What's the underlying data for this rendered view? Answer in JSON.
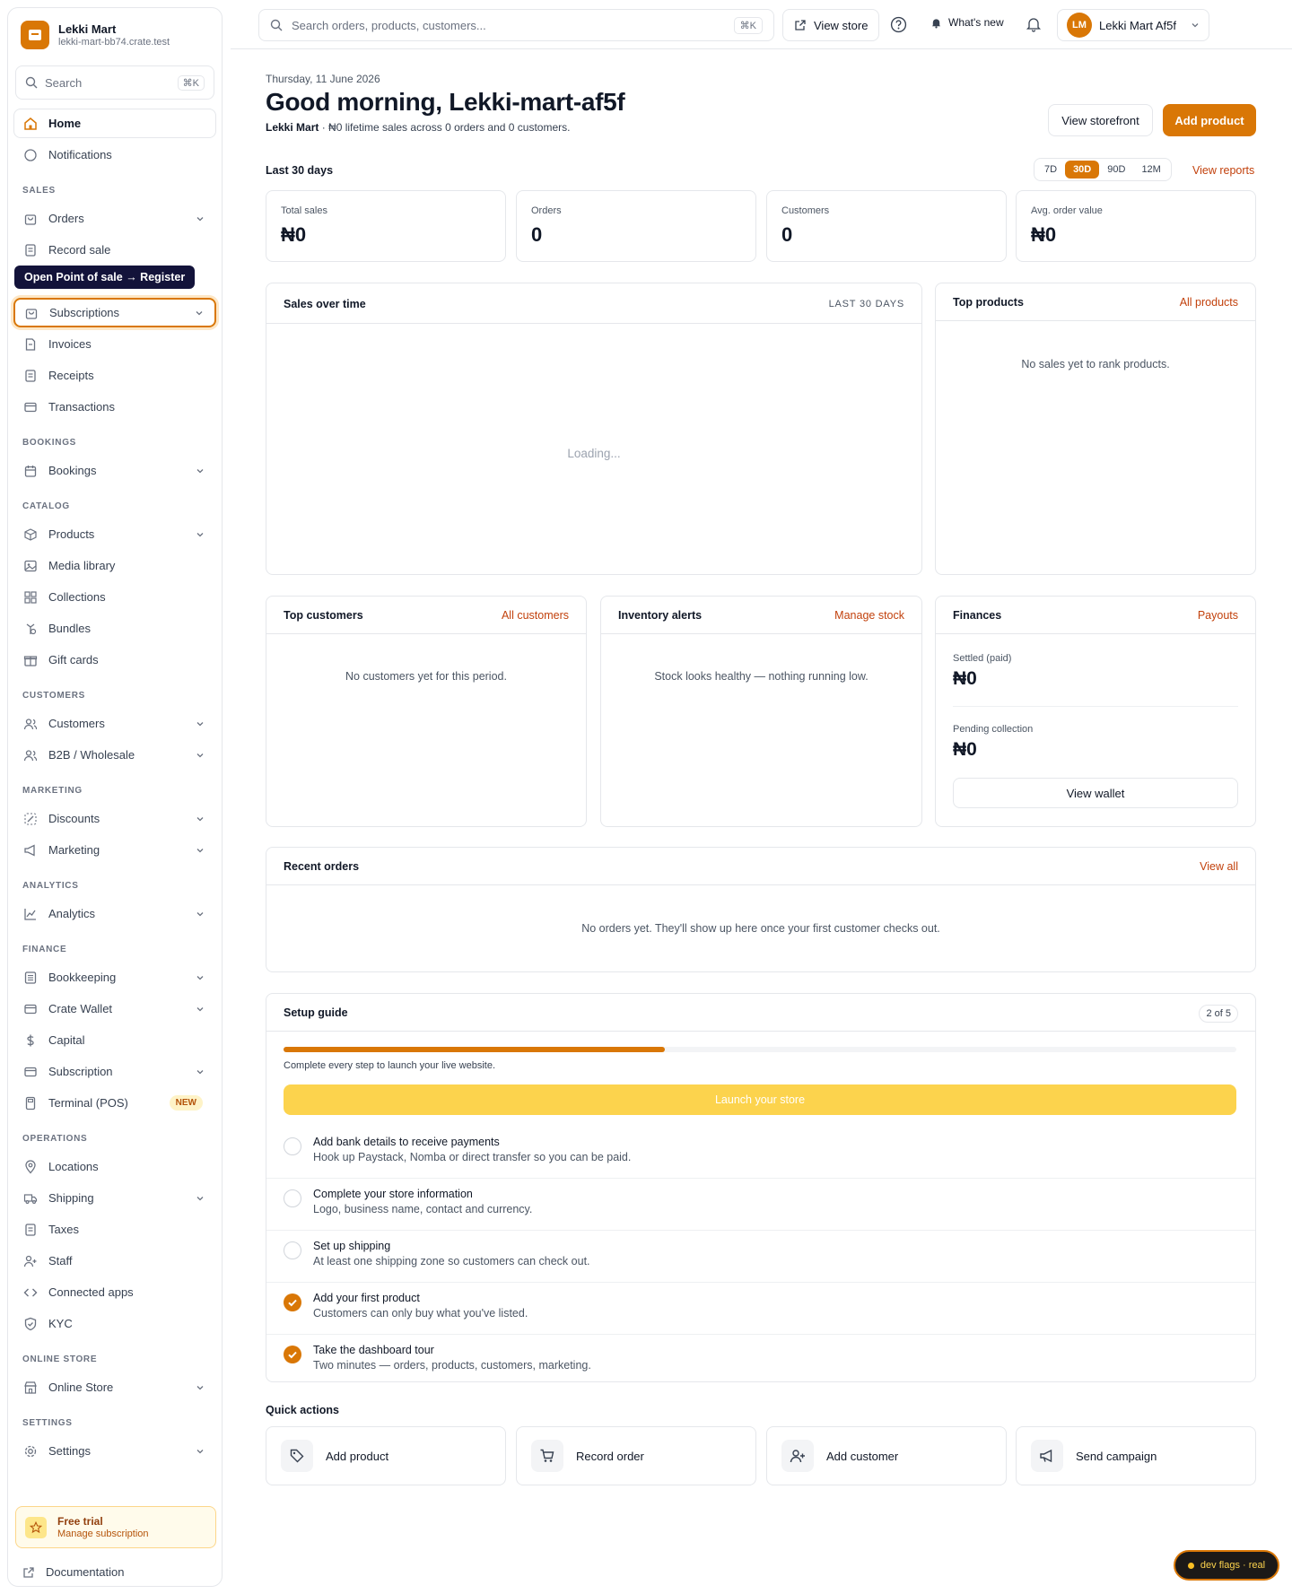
{
  "brand": {
    "name": "Lekki Mart",
    "domain": "lekki-mart-bb74.crate.test"
  },
  "sidebar_search": {
    "placeholder": "Search",
    "shortcut": "⌘K"
  },
  "nav": {
    "home": "Home",
    "notifications": "Notifications",
    "sales_header": "SALES",
    "orders": "Orders",
    "record_sale": "Record sale",
    "subscriptions": "Subscriptions",
    "invoices": "Invoices",
    "receipts": "Receipts",
    "transactions": "Transactions",
    "bookings_header": "BOOKINGS",
    "bookings": "Bookings",
    "catalog_header": "CATALOG",
    "products": "Products",
    "media_library": "Media library",
    "collections": "Collections",
    "bundles": "Bundles",
    "gift_cards": "Gift cards",
    "customers_header": "CUSTOMERS",
    "customers": "Customers",
    "b2b": "B2B / Wholesale",
    "marketing_header": "MARKETING",
    "discounts": "Discounts",
    "marketing": "Marketing",
    "analytics_header": "ANALYTICS",
    "analytics": "Analytics",
    "finance_header": "FINANCE",
    "bookkeeping": "Bookkeeping",
    "crate_wallet": "Crate Wallet",
    "capital": "Capital",
    "subscription": "Subscription",
    "terminal": "Terminal (POS)",
    "new_badge": "NEW",
    "operations_header": "OPERATIONS",
    "locations": "Locations",
    "shipping": "Shipping",
    "taxes": "Taxes",
    "staff": "Staff",
    "connected_apps": "Connected apps",
    "kyc": "KYC",
    "online_store_header": "ONLINE STORE",
    "online_store": "Online Store",
    "settings_header": "SETTINGS",
    "settings": "Settings"
  },
  "tooltip": "Open Point of sale → Register",
  "trial": {
    "title": "Free trial",
    "subtitle": "Manage subscription"
  },
  "documentation": "Documentation",
  "topbar": {
    "search_placeholder": "Search orders, products, customers...",
    "search_shortcut": "⌘K",
    "view_store": "View store",
    "whats_new": "What's new",
    "user_initials": "LM",
    "user_name": "Lekki Mart Af5f"
  },
  "header": {
    "date": "Thursday, 11 June 2026",
    "greeting": "Good morning, Lekki-mart-af5f",
    "store_name": "Lekki Mart",
    "summary": " · ₦0 lifetime sales across 0 orders and 0 customers.",
    "view_storefront": "View storefront",
    "add_product": "Add product"
  },
  "period": {
    "label": "Last 30 days",
    "options": [
      "7D",
      "30D",
      "90D",
      "12M"
    ],
    "selected": "30D",
    "view_reports": "View reports"
  },
  "kpis": [
    {
      "label": "Total sales",
      "value": "₦0"
    },
    {
      "label": "Orders",
      "value": "0"
    },
    {
      "label": "Customers",
      "value": "0"
    },
    {
      "label": "Avg. order value",
      "value": "₦0"
    }
  ],
  "sales_over_time": {
    "title": "Sales over time",
    "range": "LAST 30 DAYS",
    "loading": "Loading..."
  },
  "top_products": {
    "title": "Top products",
    "link": "All products",
    "empty": "No sales yet to rank products."
  },
  "top_customers": {
    "title": "Top customers",
    "link": "All customers",
    "empty": "No customers yet for this period."
  },
  "inventory": {
    "title": "Inventory alerts",
    "link": "Manage stock",
    "empty": "Stock looks healthy — nothing running low."
  },
  "finances": {
    "title": "Finances",
    "link": "Payouts",
    "settled_label": "Settled (paid)",
    "settled_value": "₦0",
    "pending_label": "Pending collection",
    "pending_value": "₦0",
    "wallet_button": "View wallet"
  },
  "recent_orders": {
    "title": "Recent orders",
    "link": "View all",
    "empty": "No orders yet. They'll show up here once your first customer checks out."
  },
  "setup": {
    "title": "Setup guide",
    "progress_text": "2 of 5",
    "progress": 0.4,
    "hint": "Complete every step to launch your live website.",
    "launch": "Launch your store",
    "steps": [
      {
        "title": "Add bank details to receive payments",
        "desc": "Hook up Paystack, Nomba or direct transfer so you can be paid.",
        "done": false
      },
      {
        "title": "Complete your store information",
        "desc": "Logo, business name, contact and currency.",
        "done": false
      },
      {
        "title": "Set up shipping",
        "desc": "At least one shipping zone so customers can check out.",
        "done": false
      },
      {
        "title": "Add your first product",
        "desc": "Customers can only buy what you've listed.",
        "done": true
      },
      {
        "title": "Take the dashboard tour",
        "desc": "Two minutes — orders, products, customers, marketing.",
        "done": true
      }
    ]
  },
  "quick_actions": {
    "title": "Quick actions",
    "items": [
      {
        "label": "Add product",
        "icon": "tag-icon"
      },
      {
        "label": "Record order",
        "icon": "cart-icon"
      },
      {
        "label": "Add customer",
        "icon": "user-plus-icon"
      },
      {
        "label": "Send campaign",
        "icon": "megaphone-icon"
      }
    ]
  },
  "dev_flags": "dev flags · real",
  "colors": {
    "accent": "#d97706",
    "tooltip_bg": "#13133a",
    "launch_button": "#fcd34d"
  }
}
